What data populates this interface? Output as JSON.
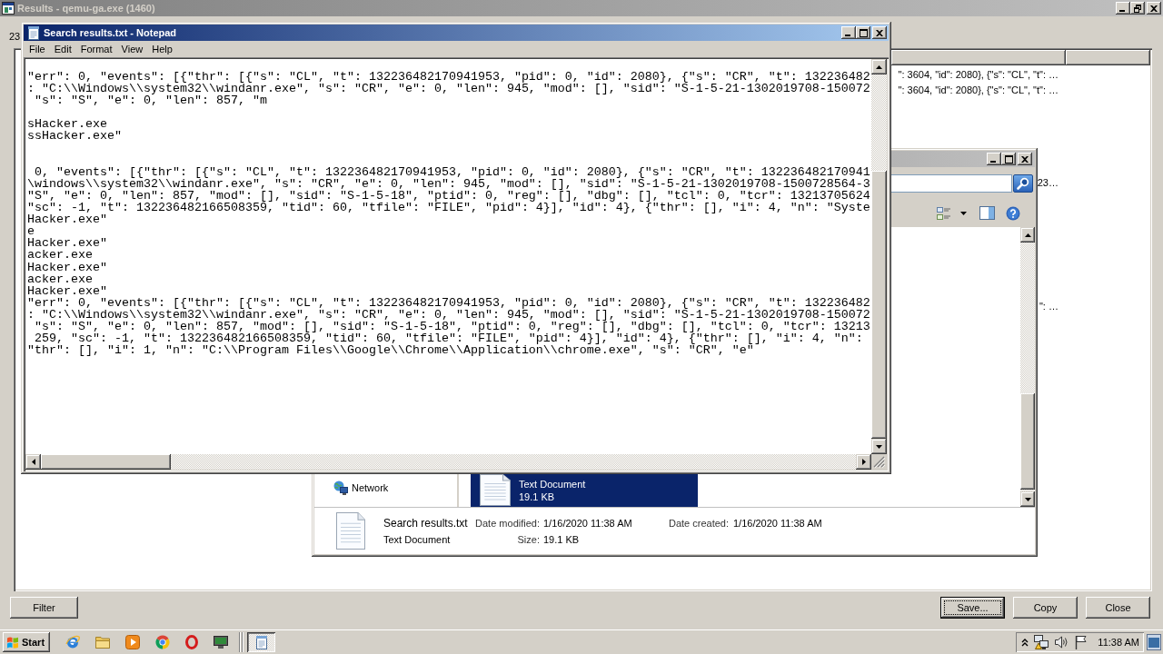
{
  "results_window": {
    "title": "Results - qemu-ga.exe (1460)",
    "active": false,
    "count_label": "23",
    "list_rows": [
      {
        "text": "\": 3604, \"id\": 2080}, {\"s\": \"CL\", \"t\": …",
        "selected": false
      },
      {
        "text": "\": 3604, \"id\": 2080}, {\"s\": \"CL\", \"t\": …",
        "selected": false
      },
      {
        "text": "23…",
        "selected": false
      },
      {
        "text": "\": …",
        "selected": false
      }
    ],
    "left_buttons": [
      {
        "label": "Filter",
        "default": false
      }
    ],
    "right_buttons": [
      {
        "label": "Save...",
        "default": true
      },
      {
        "label": "Copy",
        "default": false
      },
      {
        "label": "Close",
        "default": false
      }
    ]
  },
  "explorer_window": {
    "active": false,
    "nav_items": [
      {
        "label": "Network",
        "selected": false
      }
    ],
    "files": [
      {
        "type_label": "Text Document",
        "size": "19.1 KB",
        "selected": true
      }
    ],
    "details": {
      "name": "Search results.txt",
      "type": "Text Document",
      "fields": [
        {
          "label": "Date modified:",
          "value": "1/16/2020 11:38 AM"
        },
        {
          "label": "Date created:",
          "value": "1/16/2020 11:38 AM"
        },
        {
          "label": "Size:",
          "value": "19.1 KB"
        }
      ]
    }
  },
  "notepad_window": {
    "title": "Search results.txt - Notepad",
    "active": true,
    "menu": [
      "File",
      "Edit",
      "Format",
      "View",
      "Help"
    ],
    "text": "\"err\": 0, \"events\": [{\"thr\": [{\"s\": \"CL\", \"t\": 132236482170941953, \"pid\": 0, \"id\": 2080}, {\"s\": \"CR\", \"t\": 132236482\n: \"C:\\\\Windows\\\\system32\\\\windanr.exe\", \"s\": \"CR\", \"e\": 0, \"len\": 945, \"mod\": [], \"sid\": \"S-1-5-21-1302019708-150072\n \"s\": \"S\", \"e\": 0, \"len\": 857, \"m\n\nsHacker.exe\nssHacker.exe\"\n\n\n 0, \"events\": [{\"thr\": [{\"s\": \"CL\", \"t\": 132236482170941953, \"pid\": 0, \"id\": 2080}, {\"s\": \"CR\", \"t\": 132236482170941\n\\windows\\\\system32\\\\windanr.exe\", \"s\": \"CR\", \"e\": 0, \"len\": 945, \"mod\": [], \"sid\": \"S-1-5-21-1302019708-1500728564-3\n\"S\", \"e\": 0, \"len\": 857, \"mod\": [], \"sid\": \"S-1-5-18\", \"ptid\": 0, \"reg\": [], \"dbg\": [], \"tcl\": 0, \"tcr\": 13213705624\n\"sc\": -1, \"t\": 132236482166508359, \"tid\": 60, \"tfile\": \"FILE\", \"pid\": 4}], \"id\": 4}, {\"thr\": [], \"i\": 4, \"n\": \"Syste\nHacker.exe\"\ne\nHacker.exe\"\nacker.exe\nHacker.exe\"\nacker.exe\nHacker.exe\"\n\"err\": 0, \"events\": [{\"thr\": [{\"s\": \"CL\", \"t\": 132236482170941953, \"pid\": 0, \"id\": 2080}, {\"s\": \"CR\", \"t\": 132236482\n: \"C:\\\\Windows\\\\system32\\\\windanr.exe\", \"s\": \"CR\", \"e\": 0, \"len\": 945, \"mod\": [], \"sid\": \"S-1-5-21-1302019708-150072\n \"s\": \"S\", \"e\": 0, \"len\": 857, \"mod\": [], \"sid\": \"S-1-5-18\", \"ptid\": 0, \"reg\": [], \"dbg\": [], \"tcl\": 0, \"tcr\": 13213\n 259, \"sc\": -1, \"t\": 132236482166508359, \"tid\": 60, \"tfile\": \"FILE\", \"pid\": 4}], \"id\": 4}, {\"thr\": [], \"i\": 4, \"n\":\n\"thr\": [], \"i\": 1, \"n\": \"C:\\\\Program Files\\\\Google\\\\Chrome\\\\Application\\\\chrome.exe\", \"s\": \"CR\", \"e\""
  },
  "taskbar": {
    "start_label": "Start",
    "quick_launch": [
      {
        "kind": "ie"
      },
      {
        "kind": "folder"
      },
      {
        "kind": "media"
      },
      {
        "kind": "chrome"
      },
      {
        "kind": "opera"
      },
      {
        "kind": "computer"
      }
    ],
    "tasks": [
      {
        "kind": "notepad",
        "selected": true
      }
    ],
    "tray_icons": [
      {
        "kind": "chevron"
      },
      {
        "kind": "network"
      },
      {
        "kind": "speaker"
      },
      {
        "kind": "flag"
      }
    ],
    "clock": "11:38 AM"
  }
}
